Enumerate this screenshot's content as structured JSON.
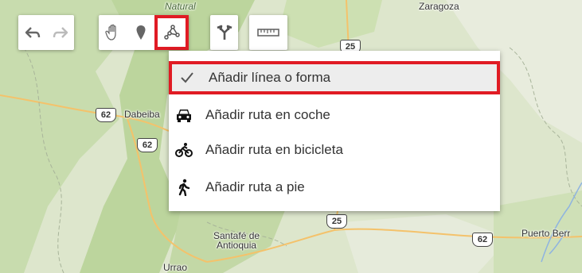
{
  "map": {
    "places": {
      "natural": "Natural",
      "zaragoza": "Zaragoza",
      "dabeiba": "Dabeiba",
      "santafe": "Santafé de\nAntioquia",
      "urrao": "Urrao",
      "puerto": "Puerto Berr"
    },
    "shields": {
      "r25_top": "25",
      "r62_a": "62",
      "r62_b": "62",
      "r25_bottom": "25",
      "r62_right": "62"
    }
  },
  "toolbar": {
    "undo": {
      "icon": "undo-arrow-icon"
    },
    "redo": {
      "icon": "redo-arrow-icon"
    },
    "pan": {
      "icon": "hand-icon"
    },
    "marker": {
      "icon": "marker-pin-icon"
    },
    "draw_line": {
      "icon": "draw-line-icon",
      "highlighted": true
    },
    "directions": {
      "icon": "directions-fork-icon"
    },
    "measure": {
      "icon": "ruler-icon"
    }
  },
  "menu": {
    "items": [
      {
        "label": "Añadir línea o forma",
        "icon": "checkmark-icon",
        "selected": true
      },
      {
        "label": "Añadir ruta en coche",
        "icon": "car-icon"
      },
      {
        "label": "Añadir ruta en bicicleta",
        "icon": "bicycle-icon"
      },
      {
        "label": "Añadir ruta a pie",
        "icon": "walking-icon"
      }
    ]
  },
  "colors": {
    "highlight": "#e01b24",
    "map_green": "#cfe0b7",
    "map_light": "#e4ead9"
  }
}
